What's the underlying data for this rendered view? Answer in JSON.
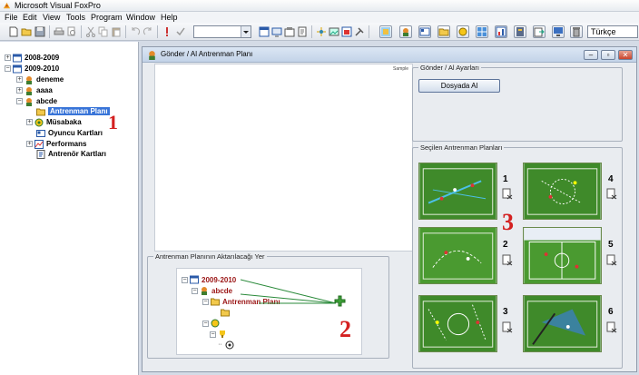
{
  "app": {
    "title": "Microsoft Visual FoxPro"
  },
  "menu": [
    "File",
    "Edit",
    "View",
    "Tools",
    "Program",
    "Window",
    "Help"
  ],
  "toolbar": {
    "language": "Türkçe"
  },
  "tree": {
    "nodes": [
      "2008-2009",
      "2009-2010",
      "deneme",
      "aaaa",
      "abcde",
      "Antrenman Planı",
      "Müsabaka",
      "Oyuncu Kartları",
      "Performans",
      "Antrenör Kartları"
    ]
  },
  "annotations": {
    "one": "1",
    "two": "2",
    "three": "3"
  },
  "window": {
    "title": "Gönder / Al  Antrenman Planı",
    "controls": {
      "minimize": "–",
      "restore": "▫",
      "close": "✕"
    },
    "preview_tiny_label": "Sample",
    "settings_group": "Gönder / Al Ayarları",
    "dosyada_button": "Dosyada Al",
    "plans_group": "Seçilen Antrenman Planları",
    "plan_numbers": [
      "1",
      "2",
      "3",
      "4",
      "5",
      "6"
    ],
    "target_group": "Antrenman Planının Aktarılacağı Yer",
    "target_tree": [
      "2009-2010",
      "abcde",
      "Antrenman Planı"
    ]
  },
  "colors": {
    "accent_red": "#d42020",
    "selection": "#3874d8",
    "pitch_green": "#3f8a2a"
  }
}
